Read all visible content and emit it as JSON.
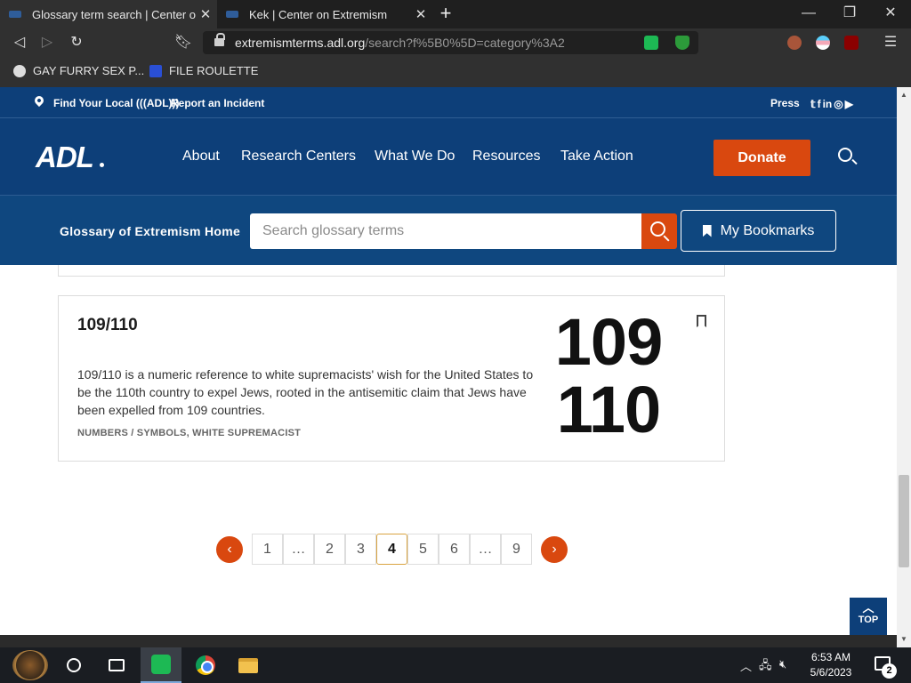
{
  "browser": {
    "tabs": [
      {
        "title": "Glossary term search | Center on Extremism",
        "active": true
      },
      {
        "title": "Kek | Center on Extremism",
        "active": false
      }
    ],
    "url_host": "extremismterms.adl.org",
    "url_path": "/search?f%5B0%5D=category%3A2",
    "bookmarks": [
      "GAY FURRY SEX P...",
      "FILE ROULETTE"
    ]
  },
  "site": {
    "util_links": {
      "local": "Find Your Local (((ADL)))",
      "report": "Report an Incident",
      "press": "Press"
    },
    "social_icons": [
      "twitter-icon",
      "facebook-icon",
      "linkedin-icon",
      "instagram-icon",
      "youtube-icon"
    ],
    "logo": "ADL",
    "menu": [
      "About",
      "Research Centers",
      "What We Do",
      "Resources",
      "Take Action"
    ],
    "donate": "Donate",
    "glossary_home": "Glossary of Extremism Home",
    "search_placeholder": "Search glossary terms",
    "my_bookmarks": "My Bookmarks"
  },
  "card": {
    "title": "109/110",
    "description": "109/110 is a numeric reference to white supremacists' wish for the United States to be the 110th country to expel Jews, rooted in the antisemitic claim that Jews have been expelled from 109 countries.",
    "tags": "NUMBERS / SYMBOLS, WHITE SUPREMACIST",
    "image_text": [
      "109",
      "110"
    ]
  },
  "pagination": {
    "prev": "‹",
    "next": "›",
    "pages": [
      "1",
      "…",
      "2",
      "3",
      "4",
      "5",
      "6",
      "…",
      "9"
    ],
    "current": "4"
  },
  "top_button": "TOP",
  "taskbar": {
    "time": "6:53 AM",
    "date": "5/6/2023",
    "notification_count": "2"
  },
  "colors": {
    "brand_blue": "#0d3f79",
    "accent_orange": "#d9480f"
  }
}
